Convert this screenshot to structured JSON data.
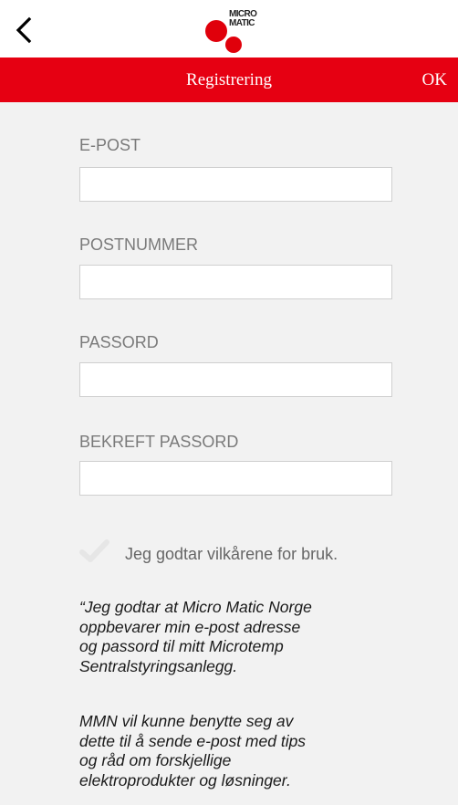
{
  "header": {
    "back_icon": "chevron-left-icon",
    "logo_line1": "MICRO",
    "logo_line2": "MATIC"
  },
  "titlebar": {
    "title": "Registrering",
    "ok_label": "OK"
  },
  "form": {
    "fields": [
      {
        "label": "E-POST",
        "value": "",
        "placeholder": ""
      },
      {
        "label": "POSTNUMMER",
        "value": "",
        "placeholder": ""
      },
      {
        "label": "PASSORD",
        "value": "",
        "placeholder": ""
      },
      {
        "label": "BEKREFT PASSORD",
        "value": "",
        "placeholder": ""
      }
    ]
  },
  "terms": {
    "check_icon": "checkmark-icon",
    "label": "Jeg godtar vilkårene for bruk."
  },
  "consent": {
    "paragraph1": "“Jeg godtar at Micro Matic Norge\noppbevarer min e-post adresse\nog passord til mitt Microtemp\nSentralstyringsanlegg.",
    "paragraph2": "MMN vil kunne benytte seg av\ndette til å sende e-post med tips\nog råd om forskjellige\nelektroprodukter og løsninger."
  },
  "colors": {
    "brand_red": "#e60012",
    "background": "#f2f2f2",
    "label_gray": "#7a7a7a"
  }
}
